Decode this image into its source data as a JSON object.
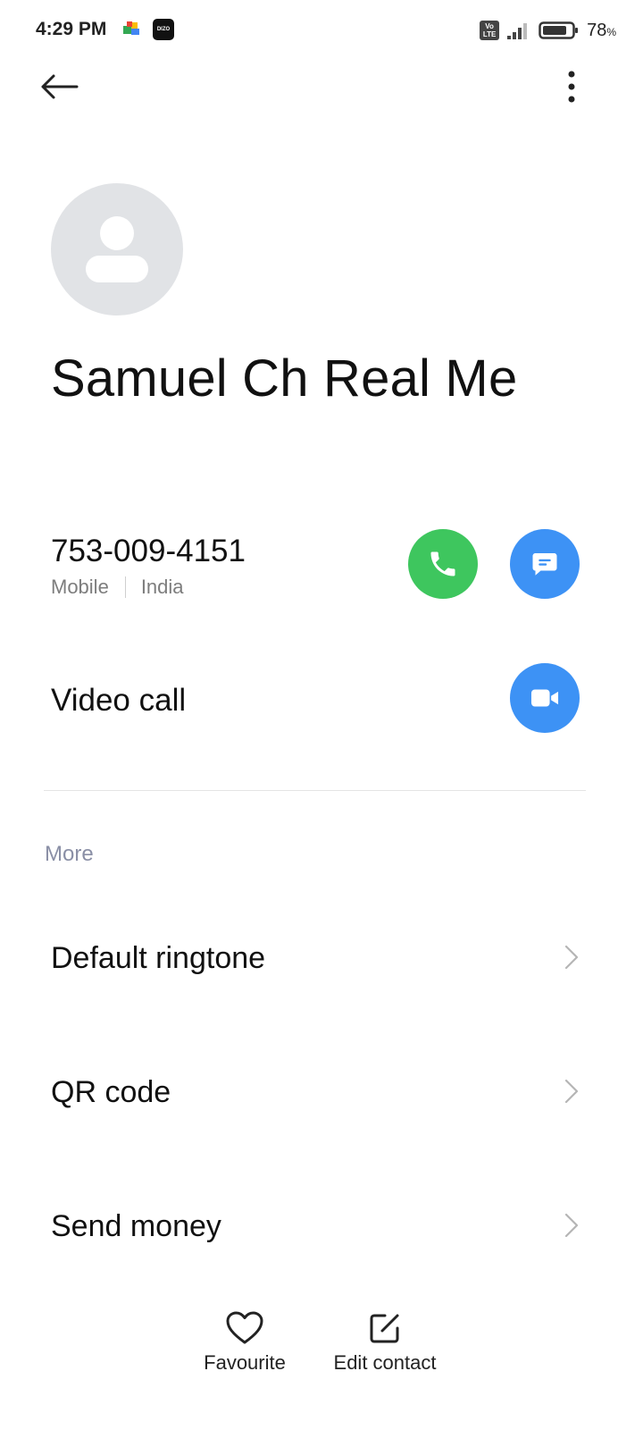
{
  "status_bar": {
    "time": "4:29 PM",
    "battery_percent": "78",
    "battery_unit": "%",
    "network_label_top": "Vo",
    "network_label_bottom": "LTE",
    "app_badge_text": "DIZO"
  },
  "toolbar": {
    "back_icon": "arrow-left-icon",
    "more_icon": "more-vertical-icon"
  },
  "contact": {
    "name": "Samuel Ch Real Me",
    "avatar_icon": "person-placeholder-icon"
  },
  "phone": {
    "number": "753-009-4151",
    "type": "Mobile",
    "location": "India",
    "call_color": "#3ec65e",
    "message_color": "#3d92f5"
  },
  "video": {
    "label": "Video call",
    "color": "#3d92f5"
  },
  "more_section": {
    "header": "More",
    "items": [
      {
        "label": "Default ringtone"
      },
      {
        "label": "QR code"
      },
      {
        "label": "Send money"
      }
    ]
  },
  "bottom_actions": {
    "favourite": "Favourite",
    "edit_contact": "Edit contact"
  }
}
